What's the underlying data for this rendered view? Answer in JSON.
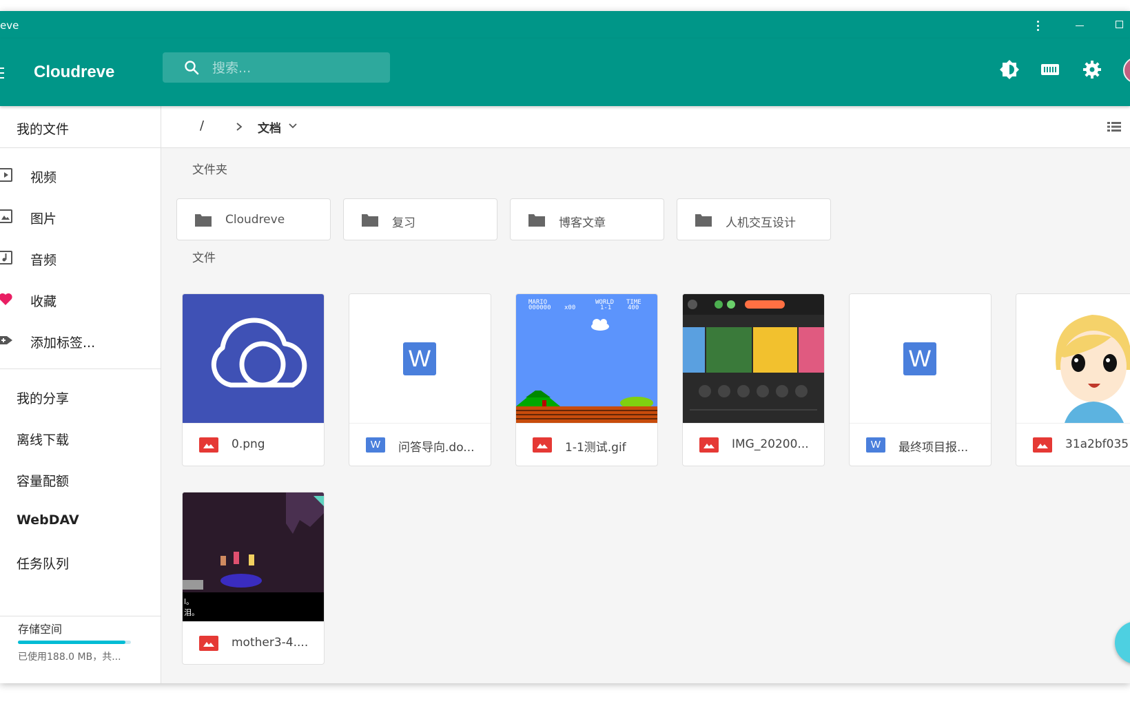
{
  "window": {
    "title": "eve"
  },
  "appbar": {
    "brand": "Cloudreve",
    "search_placeholder": "搜索...",
    "icons": [
      "menu-icon",
      "search-icon",
      "theme-toggle-icon",
      "keyboard-icon",
      "settings-icon",
      "avatar"
    ]
  },
  "sidebar": {
    "my_files": "我的文件",
    "categories": [
      {
        "label": "视频",
        "icon": "video-icon"
      },
      {
        "label": "图片",
        "icon": "image-icon"
      },
      {
        "label": "音频",
        "icon": "audio-icon"
      },
      {
        "label": "收藏",
        "icon": "heart-icon"
      },
      {
        "label": "添加标签...",
        "icon": "add-tag-icon"
      }
    ],
    "menu": [
      {
        "label": "我的分享"
      },
      {
        "label": "离线下载"
      },
      {
        "label": "容量配额"
      },
      {
        "label": "WebDAV"
      },
      {
        "label": "任务队列"
      }
    ],
    "storage": {
      "label": "存储空间",
      "used_text": "已使用188.0 MB，共...",
      "used_fraction": 0.95
    }
  },
  "breadcrumb": {
    "root": "/",
    "current": "文档"
  },
  "sections": {
    "folders": "文件夹",
    "files": "文件"
  },
  "folders": [
    {
      "name": "Cloudreve"
    },
    {
      "name": "复习"
    },
    {
      "name": "博客文章"
    },
    {
      "name": "人机交互设计"
    }
  ],
  "files": [
    {
      "name": "0.png",
      "type": "image",
      "thumb": "cloud-logo"
    },
    {
      "name": "问答导向.do...",
      "type": "word",
      "thumb": "word"
    },
    {
      "name": "1-1测试.gif",
      "type": "image",
      "thumb": "mario"
    },
    {
      "name": "IMG_20200...",
      "type": "image",
      "thumb": "switch"
    },
    {
      "name": "最终项目报...",
      "type": "word",
      "thumb": "word"
    },
    {
      "name": "31a2bf035",
      "type": "image",
      "thumb": "anime"
    },
    {
      "name": "mother3-4....",
      "type": "image",
      "thumb": "mother3"
    }
  ],
  "thumb_text": {
    "word_letter": "W",
    "mario_hud": [
      "MARIO",
      "WORLD",
      "TIME",
      "000000",
      "x00",
      "1-1",
      "400"
    ],
    "mother3_caption": [
      "l。",
      "泪。"
    ]
  },
  "colors": {
    "primary": "#009688",
    "folder": "#666666",
    "image_badge": "#e53935",
    "word_badge": "#4a7fdc"
  }
}
